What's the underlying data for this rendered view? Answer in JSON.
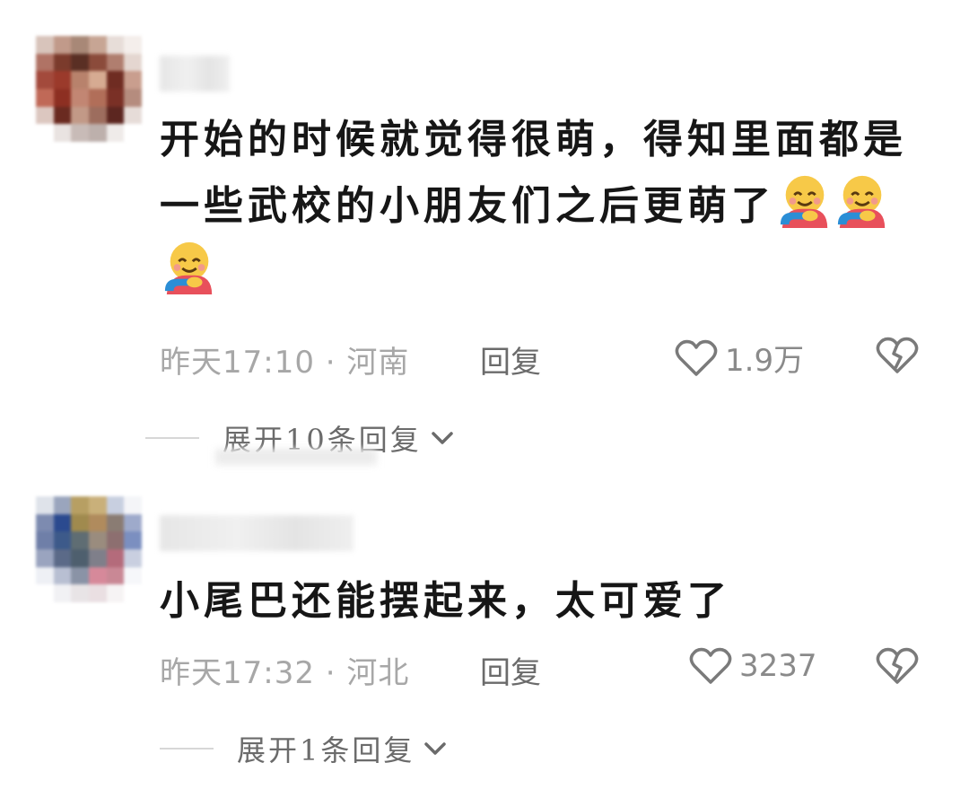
{
  "comments": [
    {
      "text": "开始的时候就觉得很萌，得知里面都是一些武校的小朋友们之后更萌了",
      "emojis": [
        "smiling-face-with-hearts-hugging-emoji",
        "smiling-face-with-hearts-hugging-emoji",
        "smiling-face-with-hearts-hugging-emoji"
      ],
      "time_location": "昨天17:10 · 河南",
      "reply_label": "回复",
      "likes": "1.9万",
      "expand_label": "展开10条回复"
    },
    {
      "text": "小尾巴还能摆起来，太可爱了",
      "time_location": "昨天17:32 · 河北",
      "reply_label": "回复",
      "likes": "3237",
      "expand_label": "展开1条回复"
    }
  ],
  "colors": {
    "text": "#161616",
    "meta": "#a7a7a7",
    "reply": "#6b6b6b",
    "divider": "#d7d7d7"
  },
  "icons": [
    "heart-outline-icon",
    "broken-heart-icon",
    "chevron-down-icon"
  ]
}
